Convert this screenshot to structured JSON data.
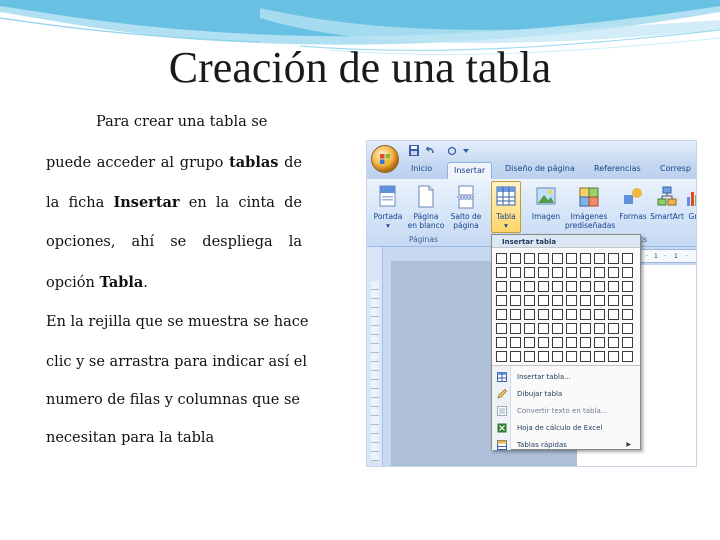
{
  "slide": {
    "title": "Creación de una tabla",
    "body": {
      "l1": "Para crear una tabla se",
      "l2a": "puede acceder al grupo ",
      "l2b": "tablas",
      "l2c": " de",
      "l3a": "la ficha ",
      "l3b": "Insertar",
      "l3c": " en la cinta de",
      "l4": "opciones, ahí se despliega la",
      "l5a": "opción ",
      "l5b": "Tabla",
      "l5c": ".",
      "l6": "En la rejilla que se muestra se hace",
      "l7": "clic y se arrastra para indicar así el",
      "l8": "numero de filas y columnas que se",
      "l9": "necesitan para la tabla"
    }
  },
  "word": {
    "tabs": [
      "Inicio",
      "Insertar",
      "Diseño de página",
      "Referencias",
      "Corresp"
    ],
    "active_tab": "Insertar",
    "ribbon_buttons": [
      {
        "line1": "Portada",
        "line2": "▾",
        "icon": "cover-page-icon"
      },
      {
        "line1": "Página",
        "line2": "en blanco",
        "icon": "blank-page-icon"
      },
      {
        "line1": "Salto de",
        "line2": "página",
        "icon": "page-break-icon"
      },
      {
        "line1": "Tabla",
        "line2": "▾",
        "icon": "table-icon"
      },
      {
        "line1": "Imagen",
        "line2": "",
        "icon": "picture-icon"
      },
      {
        "line1": "Imágenes",
        "line2": "prediseñadas",
        "icon": "clipart-icon"
      },
      {
        "line1": "Formas",
        "line2": "",
        "icon": "shapes-icon"
      },
      {
        "line1": "SmartArt",
        "line2": "",
        "icon": "smartart-icon"
      },
      {
        "line1": "Gr",
        "line2": "",
        "icon": "chart-icon"
      }
    ],
    "group_labels": {
      "pages": "Páginas",
      "illustrations": "cs"
    },
    "ruler": [
      "·",
      "1",
      "·",
      "1",
      "·"
    ],
    "dropdown": {
      "header": "Insertar tabla",
      "grid": {
        "columns": 10,
        "rows": 8
      },
      "items": [
        {
          "label": "Insertar tabla...",
          "icon": "insert-table-icon",
          "enabled": true,
          "submenu": false
        },
        {
          "label": "Dibujar tabla",
          "icon": "draw-table-icon",
          "enabled": true,
          "submenu": false
        },
        {
          "label": "Convertir texto en tabla...",
          "icon": "convert-text-icon",
          "enabled": false,
          "submenu": false
        },
        {
          "label": "Hoja de cálculo de Excel",
          "icon": "excel-icon",
          "enabled": true,
          "submenu": false
        },
        {
          "label": "Tablas rápidas",
          "icon": "quick-tables-icon",
          "enabled": true,
          "submenu": true
        }
      ]
    },
    "colors": {
      "ribbon_text": "#15428b",
      "highlight": "#ffd56a",
      "document_bg": "#aebfd8"
    }
  }
}
